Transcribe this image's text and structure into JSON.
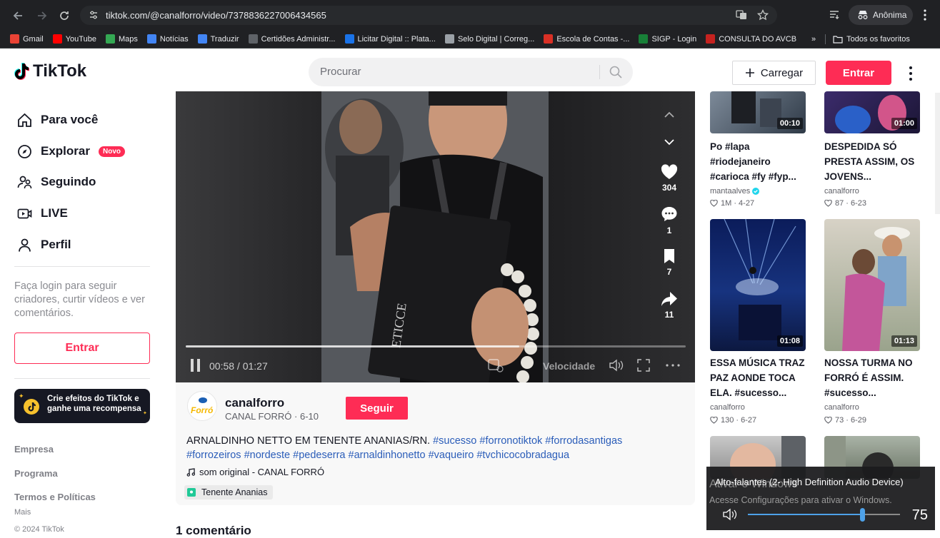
{
  "browser": {
    "url": "tiktok.com/@canalforro/video/7378836227006434565",
    "profile_label": "Anônima",
    "bookmarks": [
      {
        "label": "Gmail",
        "color": "#ea4335"
      },
      {
        "label": "YouTube",
        "color": "#ff0000"
      },
      {
        "label": "Maps",
        "color": "#34a853"
      },
      {
        "label": "Notícias",
        "color": "#4285f4"
      },
      {
        "label": "Traduzir",
        "color": "#4285f4"
      },
      {
        "label": "Certidões Administr...",
        "color": "#5f6368"
      },
      {
        "label": "Licitar Digital :: Plata...",
        "color": "#1a73e8"
      },
      {
        "label": "Selo Digital | Correg...",
        "color": "#9aa0a6"
      },
      {
        "label": "Escola de Contas -...",
        "color": "#d93025"
      },
      {
        "label": "SIGP - Login",
        "color": "#188038"
      },
      {
        "label": "CONSULTA DO AVCB",
        "color": "#c5221f"
      }
    ],
    "more_bookmarks": "»",
    "all_favorites": "Todos os favoritos"
  },
  "header": {
    "logo_text": "TikTok",
    "search_placeholder": "Procurar",
    "upload_label": "Carregar",
    "login_label": "Entrar"
  },
  "sidebar": {
    "items": [
      {
        "label": "Para você"
      },
      {
        "label": "Explorar",
        "badge": "Novo"
      },
      {
        "label": "Seguindo"
      },
      {
        "label": "LIVE"
      },
      {
        "label": "Perfil"
      }
    ],
    "login_prompt": "Faça login para seguir criadores, curtir vídeos e ver comentários.",
    "login_label": "Entrar",
    "effects_banner": "Crie efeitos do TikTok e ganhe uma recompensa",
    "footer": [
      "Empresa",
      "Programa",
      "Termos e Políticas"
    ],
    "more": "Mais",
    "copyright": "© 2024 TikTok"
  },
  "video": {
    "time": "00:58 / 01:27",
    "progress": 0.667,
    "speed_label": "Velocidade",
    "likes": "304",
    "comments": "1",
    "saves": "7",
    "shares": "11"
  },
  "author": {
    "username": "canalforro",
    "display": "CANAL FORRÓ · 6-10",
    "follow_label": "Seguir",
    "description_text": "ARNALDINHO NETTO EM TENENTE ANANIAS/RN.",
    "hashtags": [
      "#sucesso",
      "#forronotiktok",
      "#forrodasantigas",
      "#forrozeiros",
      "#nordeste",
      "#pedeserra",
      "#arnaldinhonetto",
      "#vaqueiro",
      "#tvchicocobradagua"
    ],
    "sound": "som original - CANAL FORRÓ",
    "location": "Tenente Ananias"
  },
  "comments_title": "1 comentário",
  "related": [
    {
      "duration": "00:10",
      "title": "Po #lapa #riodejaneiro #carioca #fy #fyp...",
      "author": "mantaalves",
      "verified": true,
      "stats": "1M · 4-27"
    },
    {
      "duration": "01:00",
      "title": "DESPEDIDA SÓ PRESTA ASSIM, OS JOVENS...",
      "author": "canalforro",
      "verified": false,
      "stats": "87 · 6-23"
    },
    {
      "duration": "01:08",
      "title": "ESSA MÚSICA TRAZ PAZ AONDE TOCA ELA. #sucesso...",
      "author": "canalforro",
      "verified": false,
      "stats": "130 · 6-27"
    },
    {
      "duration": "01:13",
      "title": "NOSSA TURMA NO FORRÓ É ASSIM. #sucesso...",
      "author": "canalforro",
      "verified": false,
      "stats": "73 · 6-29"
    }
  ],
  "volume_popup": {
    "device": "Alto-falantes (2- High Definition Audio Device)",
    "activate_title": "Ativar o Windows",
    "activate_text": "Acesse Configurações para ativar o Windows.",
    "level": 75
  }
}
